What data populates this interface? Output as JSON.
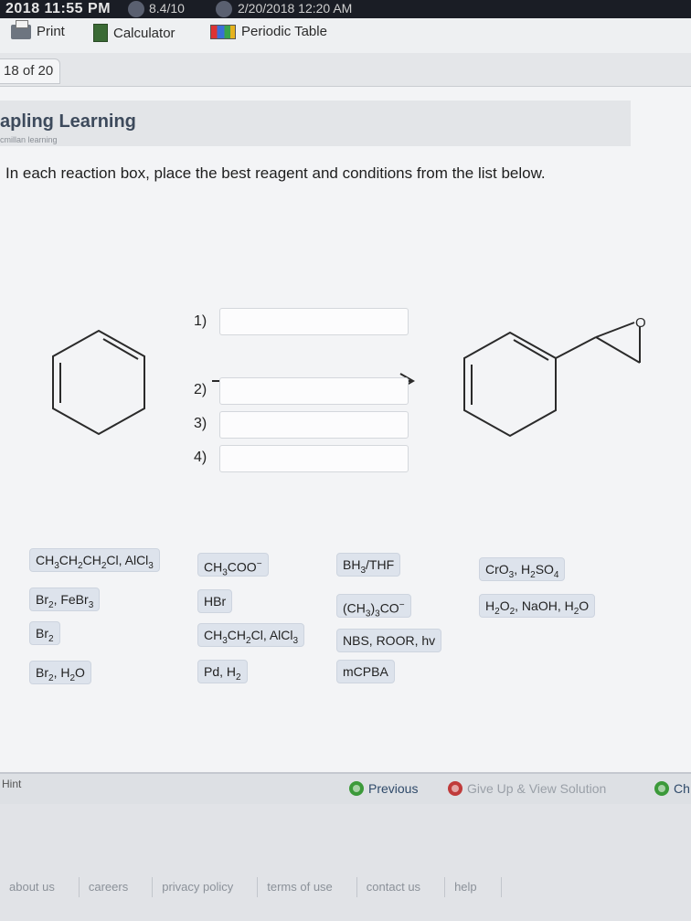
{
  "status_bar": {
    "clock": "2018 11:55 PM",
    "fragment_a": "8.4/10",
    "fragment_b": "2/20/2018 12:20 AM"
  },
  "toolbar": {
    "print": "Print",
    "calculator": "Calculator",
    "periodic_table": "Periodic Table"
  },
  "question_tab": {
    "label": "18 of 20"
  },
  "brand": {
    "name": "apling Learning",
    "tagline": "cmillan learning"
  },
  "instruction": "In each reaction box, place the best reagent and conditions from the list below.",
  "steps": [
    {
      "num": "1)",
      "value": ""
    },
    {
      "num": "2)",
      "value": ""
    },
    {
      "num": "3)",
      "value": ""
    },
    {
      "num": "4)",
      "value": ""
    }
  ],
  "molecule_labels": {
    "epoxide_oxygen": "O"
  },
  "reagents": {
    "col1": [
      {
        "pre": "CH",
        "s1": "3",
        "m1": "CH",
        "s2": "2",
        "m2": "CH",
        "s3": "2",
        "m3": "Cl, AlCl",
        "s4": "3"
      },
      {
        "pre": "Br",
        "s1": "2",
        "m1": ", FeBr",
        "s2": "3"
      },
      {
        "pre": "Br",
        "s1": "2"
      },
      {
        "pre": "Br",
        "s1": "2",
        "m1": ", H",
        "s2": "2",
        "m2": "O"
      }
    ],
    "col2": [
      {
        "pre": "CH",
        "s1": "3",
        "m1": "COO",
        "sup": "−"
      },
      {
        "pre": "HBr"
      },
      {
        "pre": "CH",
        "s1": "3",
        "m1": "CH",
        "s2": "2",
        "m2": "Cl, AlCl",
        "s3": "3"
      },
      {
        "pre": "Pd, H",
        "s1": "2"
      }
    ],
    "col3": [
      {
        "pre": "BH",
        "s1": "3",
        "m1": "/THF"
      },
      {
        "pre": "(CH",
        "s1": "3",
        "m1": ")",
        "s2": "3",
        "m2": "CO",
        "sup": "−"
      },
      {
        "pre": "NBS, ROOR, hv"
      },
      {
        "pre": "mCPBA"
      }
    ],
    "col4": [
      {
        "pre": "CrO",
        "s1": "3",
        "m1": ", H",
        "s2": "2",
        "m2": "SO",
        "s3": "4"
      },
      {
        "pre": "H",
        "s1": "2",
        "m1": "O",
        "s2": "2",
        "m2": ", NaOH, H",
        "s3": "2",
        "m3": "O"
      }
    ]
  },
  "hint_bar": {
    "hint": "Hint",
    "previous": "Previous",
    "give_up": "Give Up & View Solution",
    "check": "Ch"
  },
  "footer_links": [
    "about us",
    "careers",
    "privacy policy",
    "terms of use",
    "contact us",
    "help"
  ],
  "colors": {
    "chip_bg": "#dde3ec",
    "green": "#3c9a3a",
    "red": "#c03b3b",
    "brand_text": "#3d4a5c"
  }
}
